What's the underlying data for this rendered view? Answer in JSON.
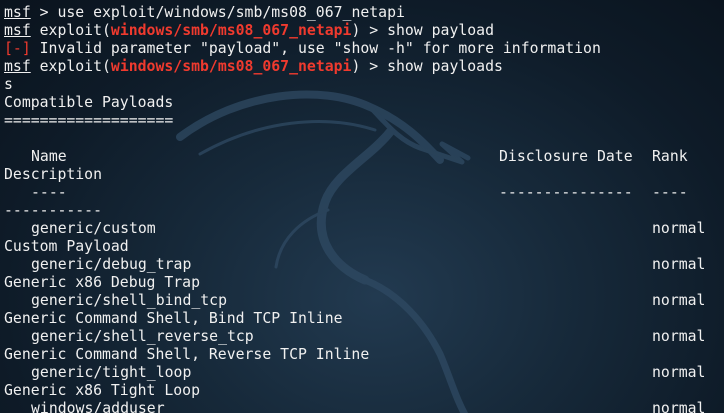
{
  "terminal": {
    "prompt_name": "msf",
    "gt": ">",
    "lines": [
      {
        "pre": "",
        "module": "",
        "post": " > use exploit/windows/smb/ms08_067_netapi"
      },
      {
        "pre": " exploit(",
        "module": "windows/smb/ms08_067_netapi",
        "post": ") > show payload"
      },
      {
        "pre": "",
        "module": "",
        "post": ""
      },
      {
        "pre": " exploit(",
        "module": "windows/smb/ms08_067_netapi",
        "post": ") > show payloads"
      }
    ],
    "error_mark": "[-]",
    "error_text": " Invalid parameter \"payload\", use \"show -h\" for more information",
    "stray_char": "s",
    "section_title": "Compatible Payloads",
    "section_rule": "===================",
    "headers": {
      "name": "Name",
      "disclosure_date": "Disclosure Date",
      "rank": "Rank",
      "description": "Description"
    },
    "header_rules": {
      "name": "----",
      "disclosure_date": "---------------",
      "rank": "----",
      "description": "-----------"
    },
    "payloads": [
      {
        "name": "generic/custom",
        "rank": "normal",
        "description": "Custom Payload"
      },
      {
        "name": "generic/debug_trap",
        "rank": "normal",
        "description": "Generic x86 Debug Trap"
      },
      {
        "name": "generic/shell_bind_tcp",
        "rank": "normal",
        "description": "Generic Command Shell, Bind TCP Inline"
      },
      {
        "name": "generic/shell_reverse_tcp",
        "rank": "normal",
        "description": "Generic Command Shell, Reverse TCP Inline"
      },
      {
        "name": "generic/tight_loop",
        "rank": "normal",
        "description": "Generic x86 Tight Loop"
      },
      {
        "name": "windows/adduser",
        "rank": "normal",
        "description": ""
      }
    ]
  },
  "colors": {
    "background": "#0b131d",
    "text": "#f0f0f0",
    "module_red": "#f03a2e"
  },
  "icons": {
    "background_logo": "kali-dragon-icon"
  }
}
